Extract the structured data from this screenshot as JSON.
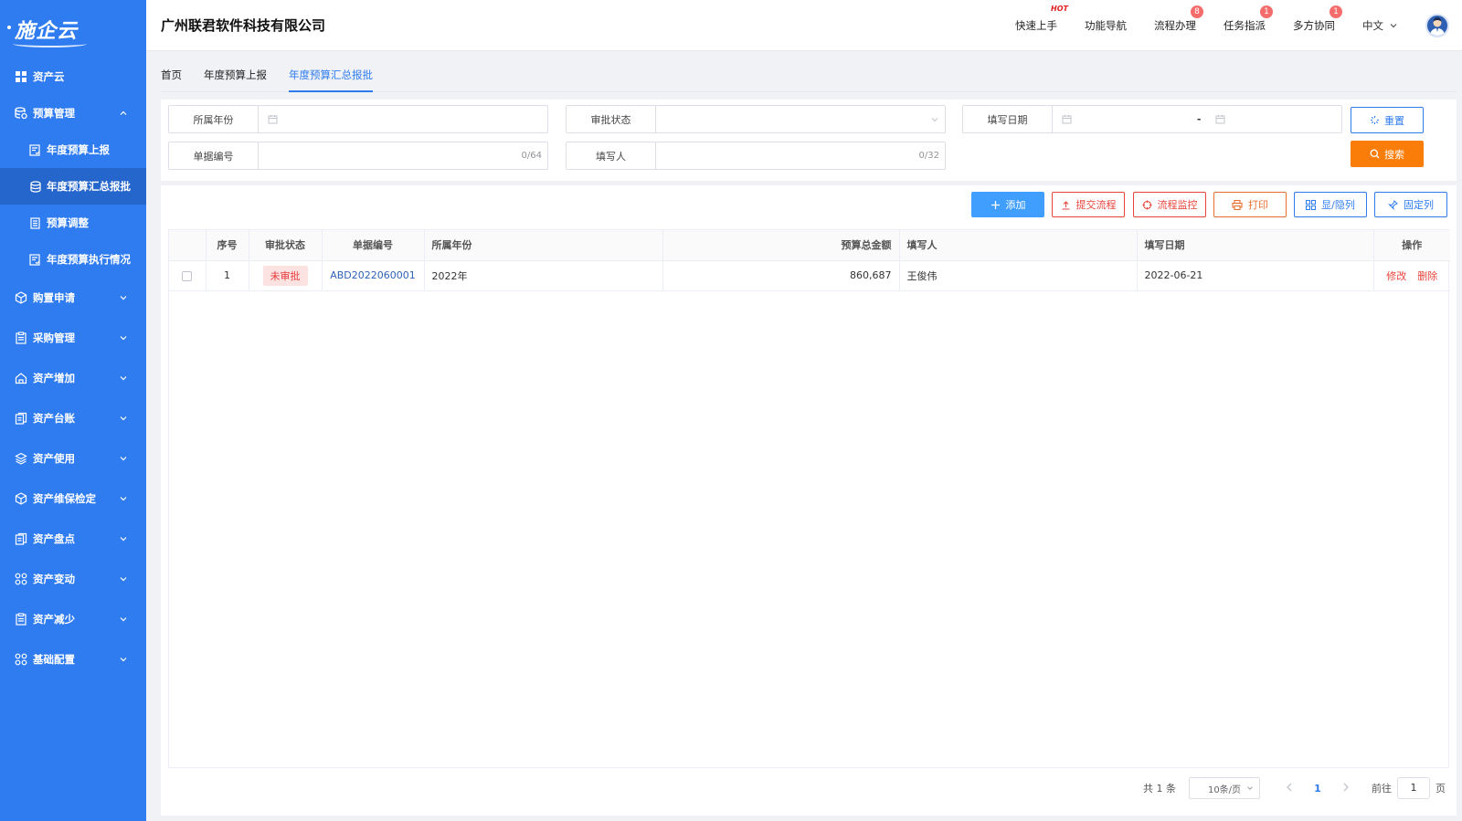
{
  "logo": {
    "text": "施企云"
  },
  "sidebar": {
    "items": [
      {
        "label": "资产云"
      },
      {
        "label": "预算管理"
      },
      {
        "label": "年度预算上报"
      },
      {
        "label": "年度预算汇总报批"
      },
      {
        "label": "预算调整"
      },
      {
        "label": "年度预算执行情况"
      },
      {
        "label": "购置申请"
      },
      {
        "label": "采购管理"
      },
      {
        "label": "资产增加"
      },
      {
        "label": "资产台账"
      },
      {
        "label": "资产使用"
      },
      {
        "label": "资产维保检定"
      },
      {
        "label": "资产盘点"
      },
      {
        "label": "资产变动"
      },
      {
        "label": "资产减少"
      },
      {
        "label": "基础配置"
      }
    ]
  },
  "header": {
    "company": "广州联君软件科技有限公司",
    "nav": [
      {
        "label": "快速上手",
        "hot": "HOT"
      },
      {
        "label": "功能导航"
      },
      {
        "label": "流程办理",
        "badge": "8"
      },
      {
        "label": "任务指派",
        "badge": "1"
      },
      {
        "label": "多方协同",
        "badge": "1"
      }
    ],
    "lang": "中文"
  },
  "tabs": [
    {
      "label": "首页"
    },
    {
      "label": "年度预算上报"
    },
    {
      "label": "年度预算汇总报批"
    }
  ],
  "search": {
    "year_label": "所属年份",
    "status_label": "审批状态",
    "date_label": "填写日期",
    "date_sep": "-",
    "doc_no_label": "单据编号",
    "doc_no_counter": "0/64",
    "writer_label": "填写人",
    "writer_counter": "0/32",
    "reset": "重置",
    "search": "搜索"
  },
  "toolbar": {
    "add": "添加",
    "submit": "提交流程",
    "monitor": "流程监控",
    "print": "打印",
    "toggle_cols": "显/隐列",
    "fix_cols": "固定列"
  },
  "table": {
    "headers": [
      "序号",
      "审批状态",
      "单据编号",
      "所属年份",
      "预算总金额",
      "填写人",
      "填写日期",
      "操作"
    ],
    "rows": [
      {
        "index": "1",
        "status": "未审批",
        "doc_no": "ABD2022060001",
        "year": "2022年",
        "amount": "860,687",
        "writer": "王俊伟",
        "date": "2022-06-21",
        "edit": "修改",
        "delete": "删除"
      }
    ]
  },
  "pager": {
    "total": "共 1 条",
    "size": "10条/页",
    "current": "1",
    "goto_prefix": "前往",
    "goto_value": "1",
    "goto_suffix": "页"
  },
  "colors": {
    "sidebar": "#2f7cf0",
    "accent": "#409eff",
    "search_btn": "#fa7d0a",
    "danger": "#e8453c"
  }
}
